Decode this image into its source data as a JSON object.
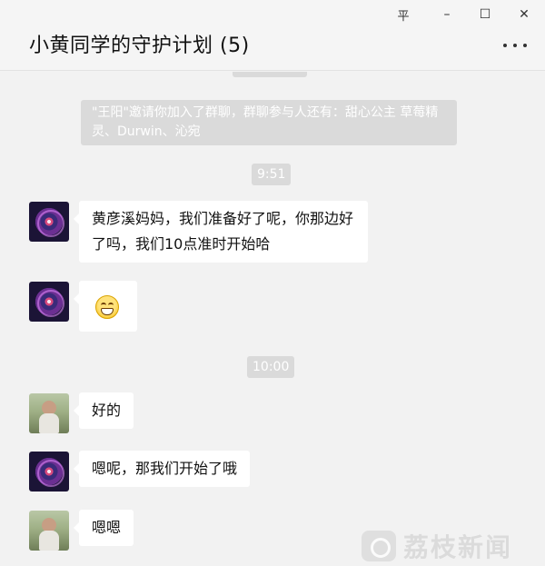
{
  "window": {
    "title": "小黄同学的守护计划 (5)",
    "controls": {
      "pin": "平",
      "minimize": "–",
      "maximize": "☐",
      "close": "✕"
    }
  },
  "chat": {
    "system_message": "\"王阳\"邀请你加入了群聊，群聊参与人还有：甜心公主  草莓精灵、Durwin、沁宛",
    "timestamps": [
      "9:51",
      "10:00"
    ],
    "messages": [
      {
        "avatar": "galaxy-avatar",
        "text": "黄彦溪妈妈，我们准备好了呢，你那边好了吗，我们10点准时开始哈"
      },
      {
        "avatar": "galaxy-avatar",
        "emoji": "grinning-face-emoji"
      },
      {
        "avatar": "person-avatar",
        "text": "好的"
      },
      {
        "avatar": "galaxy-avatar",
        "text": "嗯呢，那我们开始了哦"
      },
      {
        "avatar": "person-avatar",
        "text": "嗯嗯"
      }
    ]
  },
  "watermark": {
    "text": "荔枝新闻"
  }
}
